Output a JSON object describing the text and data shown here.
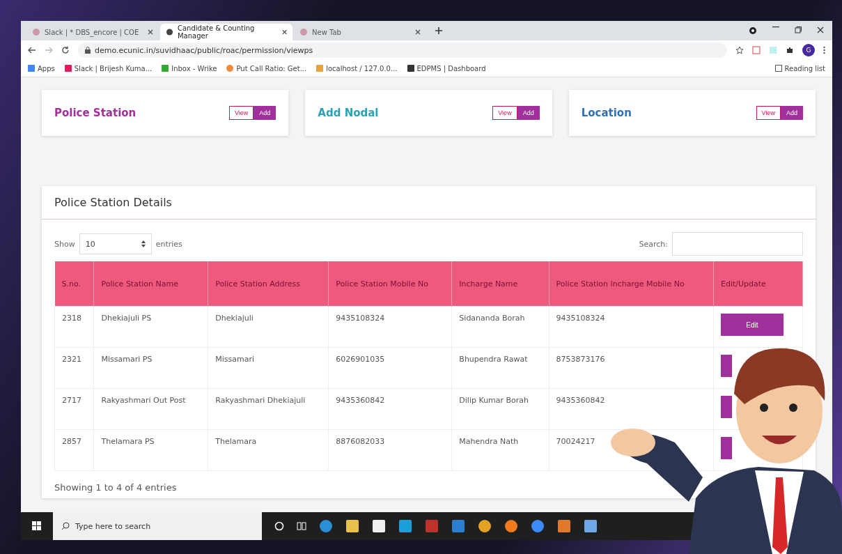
{
  "browser": {
    "tabs": [
      {
        "title": "Slack | * DBS_encore | COE",
        "selected": false
      },
      {
        "title": "Candidate & Counting Manager",
        "selected": true
      },
      {
        "title": "New Tab",
        "selected": false
      }
    ],
    "url": "demo.ecunic.in/suvidhaac/public/roac/permission/viewps",
    "bookmarks": [
      "Apps",
      "Slack | Brijesh Kuma...",
      "Inbox - Wrike",
      "Put Call Ratio: Get...",
      "localhost / 127.0.0...",
      "EDPMS | Dashboard"
    ],
    "reading_list": "Reading list",
    "profile": "G"
  },
  "cards": [
    {
      "title": "Police Station",
      "view": "View",
      "add": "Add"
    },
    {
      "title": "Add Nodal",
      "view": "View",
      "add": "Add"
    },
    {
      "title": "Location",
      "view": "View",
      "add": "Add"
    }
  ],
  "panel": {
    "title": "Police Station Details",
    "show_label": "Show",
    "page_size": "10",
    "entries_label": "entries",
    "search_label": "Search:",
    "columns": [
      "S.no.",
      "Police Station Name",
      "Police Station Address",
      "Police Station Mobile No",
      "Incharge Name",
      "Police Station Incharge Mobile No",
      "Edit/Update"
    ],
    "rows": [
      {
        "cells": [
          "2318",
          "Dhekiajuli PS",
          "Dhekiajuli",
          "9435108324",
          "Sidananda Borah",
          "9435108324"
        ],
        "edit": "Edit"
      },
      {
        "cells": [
          "2321",
          "Missamari PS",
          "Missamari",
          "6026901035",
          "Bhupendra Rawat",
          "8753873176"
        ]
      },
      {
        "cells": [
          "2717",
          "Rakyashmari Out Post",
          "Rakyashmari Dhekiajuli",
          "9435360842",
          "Dilip Kumar Borah",
          "9435360842"
        ]
      },
      {
        "cells": [
          "2857",
          "Thelamara PS",
          "Thelamara",
          "8876082033",
          "Mahendra Nath",
          "70024217"
        ]
      }
    ],
    "footer": "Showing 1 to 4 of 4 entries"
  },
  "taskbar": {
    "search_placeholder": "Type here to search"
  }
}
